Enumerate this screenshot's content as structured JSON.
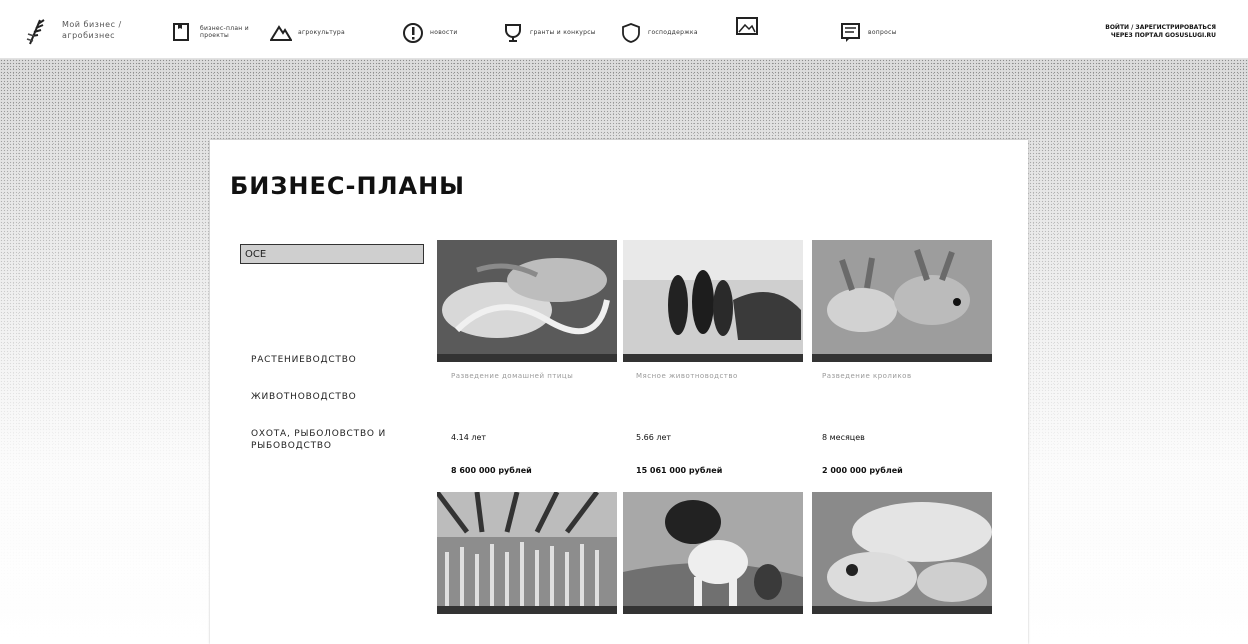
{
  "header": {
    "logo_text": "Мой бизнес / агробизнес",
    "nav": [
      {
        "label": "бизнес-план и проекты",
        "icon": "document-icon"
      },
      {
        "label": "агрокультура",
        "icon": "mountain-icon"
      },
      {
        "label": "новости",
        "icon": "info-icon"
      },
      {
        "label": "гранты и конкурсы",
        "icon": "trophy-icon"
      },
      {
        "label": "господдержка",
        "icon": "shield-icon"
      },
      {
        "label": "",
        "icon": "image-icon"
      },
      {
        "label": "вопросы",
        "icon": "chat-icon"
      }
    ],
    "login_line1": "ВОЙТИ / ЗАРЕГИСТРИРОВАТЬСЯ",
    "login_line2": "ЧЕРЕЗ ПОРТАЛ GOSUSLUGI.RU"
  },
  "page": {
    "title": "БИЗНЕС-ПЛАНЫ",
    "search_value": "ОСЕ"
  },
  "categories": [
    "РАСТЕНИЕВОДСТВО",
    "ЖИВОТНОВОДСТВО",
    "ОХОТА, РЫБОЛОВСТВО И РЫБОВОДСТВО"
  ],
  "plans": [
    {
      "image": "birds-photo",
      "desc": "Разведение домашней птицы",
      "term": "4.14 лет",
      "price": "8 600 000 рублей"
    },
    {
      "image": "people-cattle-photo",
      "desc": "Мясное животноводство",
      "term": "5.66 лет",
      "price": "15 061 000 рублей"
    },
    {
      "image": "rabbits-photo",
      "desc": "Разведение кроликов",
      "term": "8 месяцев",
      "price": "2 000 000 рублей"
    },
    {
      "image": "greenhouse-photo",
      "desc": "",
      "term": "",
      "price": ""
    },
    {
      "image": "cow-photo",
      "desc": "",
      "term": "",
      "price": ""
    },
    {
      "image": "sheep-photo",
      "desc": "",
      "term": "",
      "price": ""
    }
  ]
}
